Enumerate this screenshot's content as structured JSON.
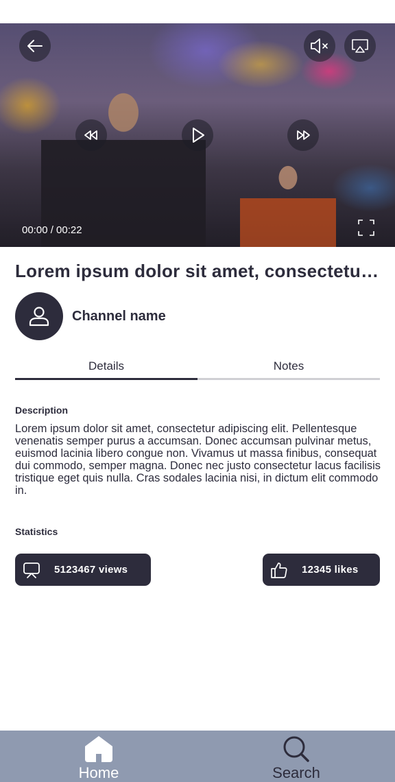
{
  "video": {
    "time": "00:00 / 00:22",
    "controls": {
      "back": "arrow-left-icon",
      "mute": "speaker-muted-icon",
      "airplay": "airplay-icon",
      "rewind": "rewind-icon",
      "play": "play-icon",
      "forward": "fast-forward-icon",
      "fullscreen": "fullscreen-icon"
    }
  },
  "content": {
    "title": "Lorem ipsum dolor sit amet, consectetur adipiscing elit.",
    "channel_name": "Channel name"
  },
  "tabs": [
    {
      "label": "Details",
      "active": true
    },
    {
      "label": "Notes",
      "active": false
    }
  ],
  "details": {
    "description_label": "Description",
    "description": "Lorem ipsum dolor sit amet, consectetur adipiscing elit. Pellentesque venenatis semper purus a accumsan. Donec accumsan pulvinar metus, euismod lacinia libero congue non. Vivamus ut massa finibus, consequat dui commodo, semper magna. Donec nec justo consectetur lacus facilisis tristique eget quis nulla. Cras sodales lacinia nisi, in dictum elit commodo in.",
    "statistics_label": "Statistics",
    "views": "5123467 views",
    "likes": "12345 likes"
  },
  "tab_bar": {
    "items": [
      {
        "label": "Home",
        "icon": "home-icon",
        "active": true
      },
      {
        "label": "Search",
        "icon": "search-icon",
        "active": false
      }
    ]
  },
  "colors": {
    "primary_dark": "#2d2c3c",
    "tab_bar_background": "#8f9ab0",
    "tab_inactive_line": "#cfcfd4"
  }
}
